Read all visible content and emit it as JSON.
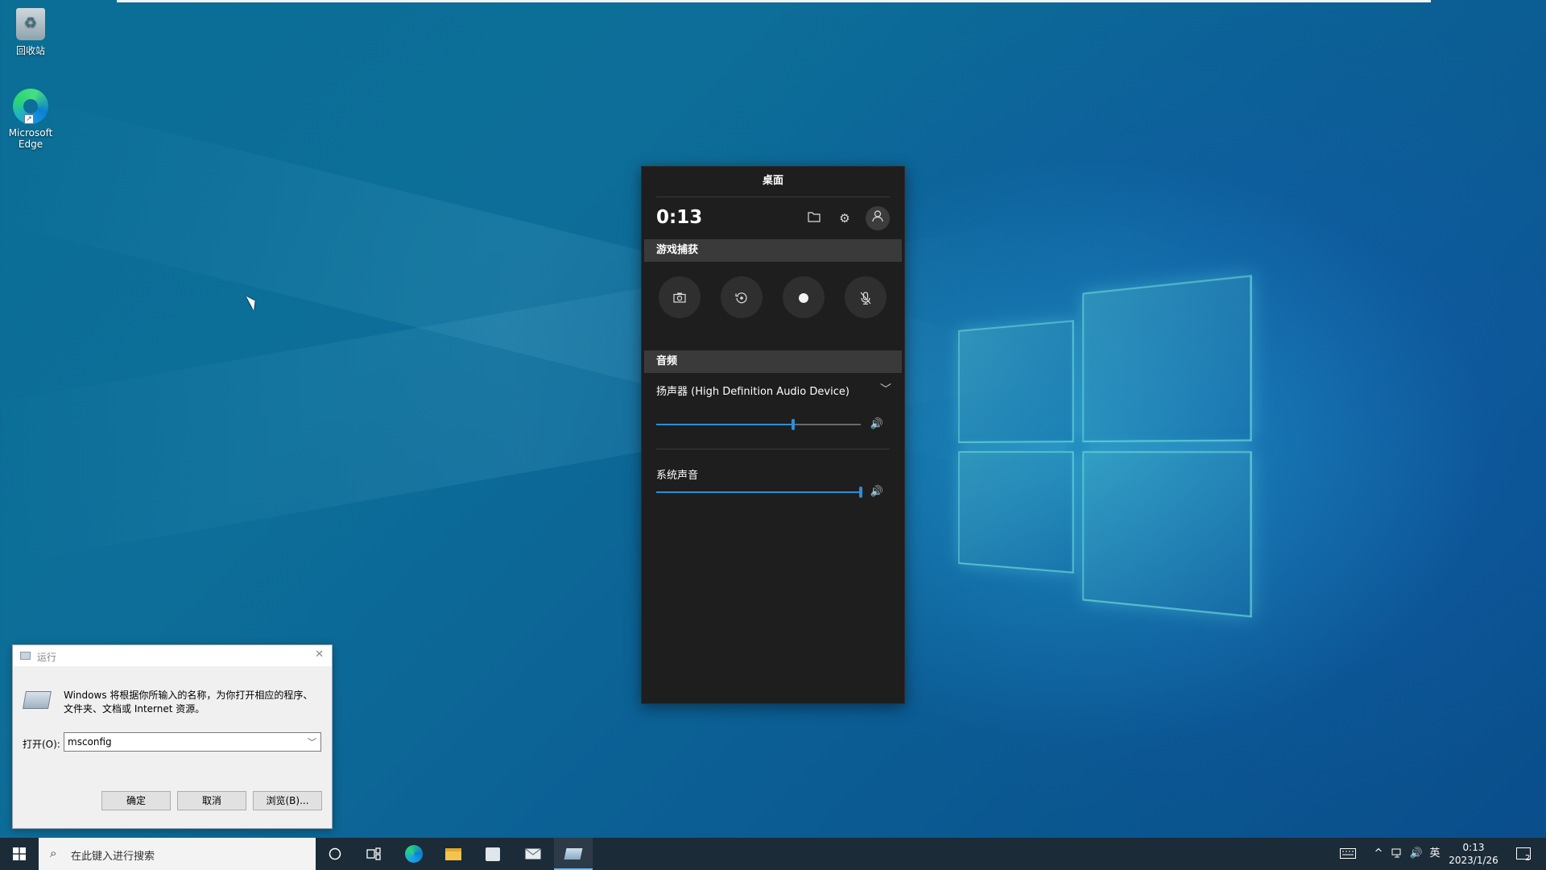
{
  "desktop": {
    "icons": [
      {
        "label": "回收站",
        "icon": "recycle-bin-icon"
      },
      {
        "label": "Microsoft Edge",
        "icon": "edge-icon"
      }
    ]
  },
  "gamebar": {
    "title": "桌面",
    "time": "0:13",
    "header_icons": [
      "folder-icon",
      "gear-icon",
      "user-icon"
    ],
    "capture": {
      "section_label": "游戏捕获",
      "buttons": [
        "screenshot-icon",
        "record-last-icon",
        "record-icon",
        "mic-off-icon"
      ]
    },
    "audio": {
      "section_label": "音频",
      "device_label": "扬声器 (High Definition Audio Device)",
      "device_volume": 0.67,
      "system_label": "系统声音",
      "system_volume": 1.0
    }
  },
  "run_dialog": {
    "title": "运行",
    "description": "Windows 将根据你所输入的名称，为你打开相应的程序、文件夹、文档或 Internet 资源。",
    "open_label": "打开(O):",
    "open_value": "msconfig",
    "ok_label": "确定",
    "cancel_label": "取消",
    "browse_label": "浏览(B)..."
  },
  "taskbar": {
    "search_placeholder": "在此键入进行搜索",
    "apps": [
      "cortana-icon",
      "task-view-icon",
      "edge-icon",
      "file-explorer-icon",
      "store-icon",
      "mail-icon",
      "run-icon"
    ],
    "tray": {
      "ime_label": "英",
      "time": "0:13",
      "date": "2023/1/26",
      "notification_count": "2"
    }
  },
  "colors": {
    "accent": "#2b8fd9",
    "gamebar_bg": "#1e1e1e",
    "taskbar_bg": "#1b2b38"
  }
}
